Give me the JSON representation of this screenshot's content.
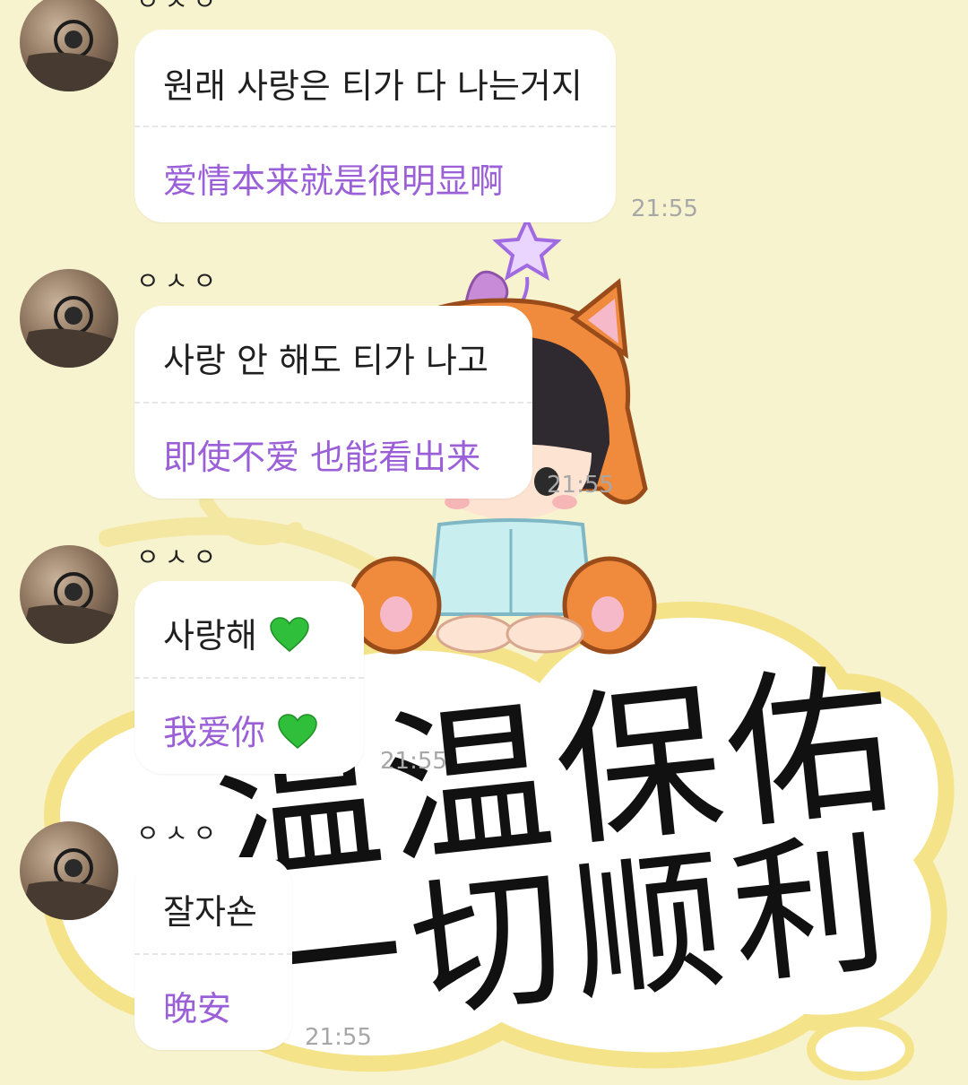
{
  "messages": [
    {
      "sender": "ㅇㅅㅇ",
      "korean": "원래 사랑은 티가 다 나는거지",
      "chinese": "爱情本来就是很明显啊",
      "time": "21:55",
      "has_heart": false
    },
    {
      "sender": "ㅇㅅㅇ",
      "korean": "사랑 안 해도 티가 나고",
      "chinese": "即使不爱 也能看出来",
      "time": "21:55",
      "has_heart": false
    },
    {
      "sender": "ㅇㅅㅇ",
      "korean": "사랑해",
      "chinese": "我爱你",
      "time": "21:55",
      "has_heart": true
    },
    {
      "sender": "ㅇㅅㅇ",
      "korean": "잘자숀",
      "chinese": "晚安",
      "time": "21:55",
      "has_heart": false
    }
  ],
  "icons": {
    "heart": "green-heart-icon",
    "star": "star-icon"
  },
  "background": {
    "cloud_text_line1": "温温保佑",
    "cloud_text_line2": "一切顺利"
  },
  "colors": {
    "background": "#f8f3cf",
    "bubble": "#ffffff",
    "translation": "#9b5fd8",
    "timestamp": "#a7a7a7",
    "heart": "#2fbf3a"
  }
}
